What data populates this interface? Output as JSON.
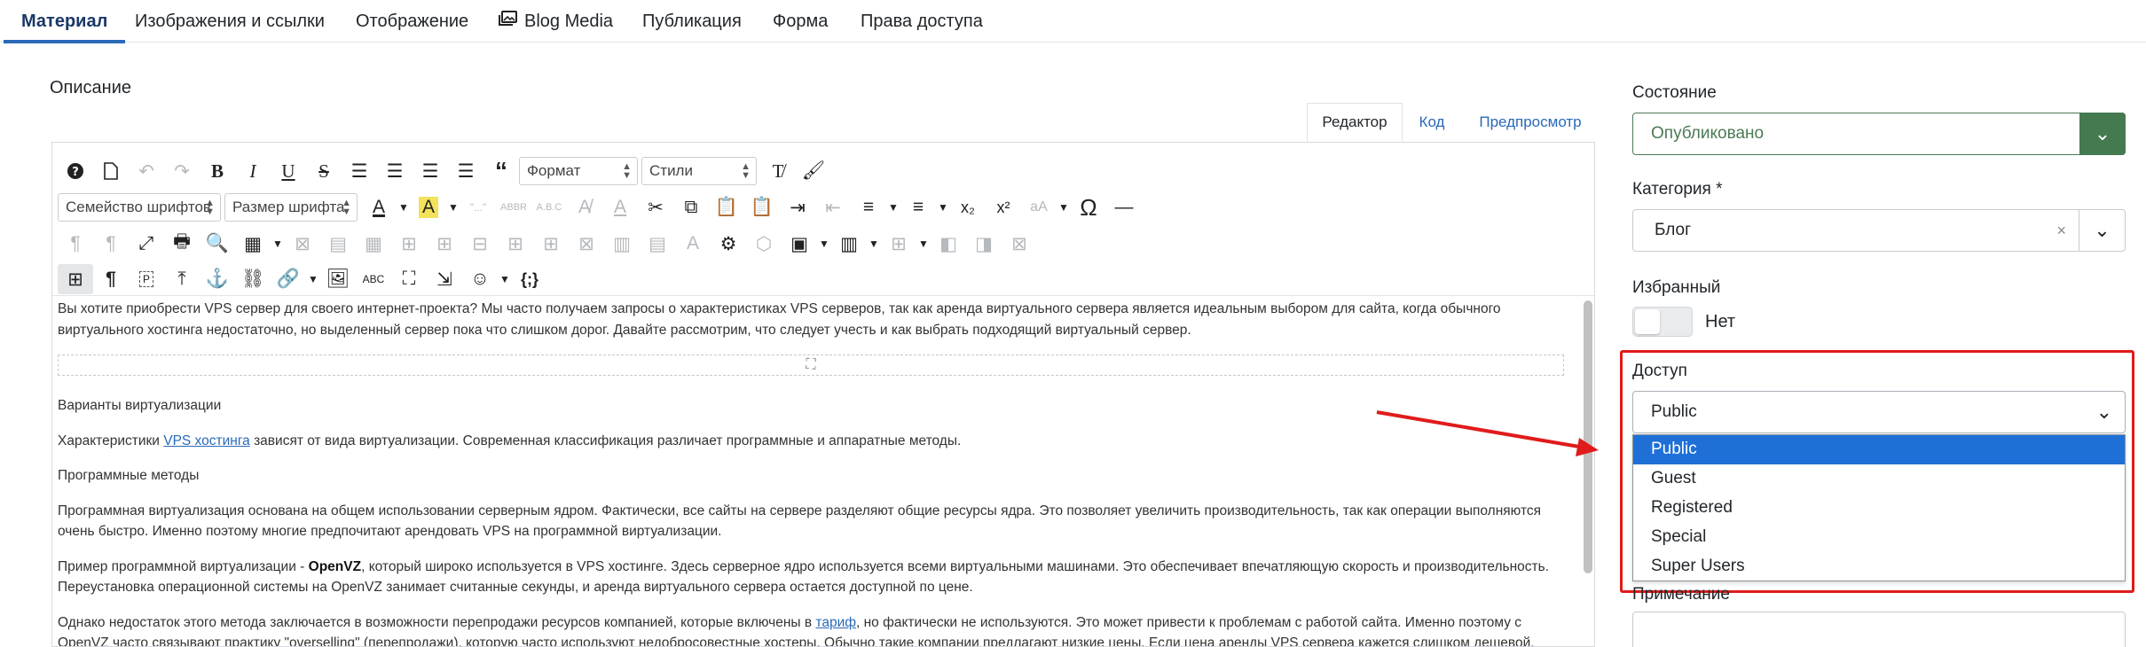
{
  "tabs": [
    {
      "label": "Материал",
      "active": true
    },
    {
      "label": "Изображения и ссылки",
      "active": false
    },
    {
      "label": "Отображение",
      "active": false
    },
    {
      "label": "Blog Media",
      "active": false,
      "icon": "images-icon"
    },
    {
      "label": "Публикация",
      "active": false
    },
    {
      "label": "Форма",
      "active": false
    },
    {
      "label": "Права доступа",
      "active": false
    }
  ],
  "description": {
    "label": "Описание",
    "editor_tabs": [
      "Редактор",
      "Код",
      "Предпросмотр"
    ],
    "toolbar": {
      "format_select": "Формат",
      "styles_select": "Стили",
      "font_family_select": "Семейство шрифтов",
      "font_size_select": "Размер шрифта"
    },
    "content": {
      "p1": "Вы хотите приобрести VPS сервер для своего интернет-проекта? Мы часто получаем запросы о характеристиках VPS серверов, так как аренда виртуального сервера является идеальным выбором для сайта, когда обычного виртуального хостинга недостаточно, но выделенный сервер пока что слишком дорог. Давайте рассмотрим, что следует учесть и как выбрать подходящий виртуальный сервер.",
      "h_virt": "Варианты виртуализации",
      "p2_before": "Характеристики ",
      "p2_link": "VPS хостинга",
      "p2_after": " зависят от вида виртуализации. Современная классификация различает программные и аппаратные методы.",
      "h_prog": "Программные методы",
      "p3": "Программная виртуализация основана на общем использовании серверным ядром. Фактически, все сайты на сервере разделяют общие ресурсы ядра. Это позволяет увеличить производительность, так как операции выполняются очень быстро. Именно поэтому многие предпочитают арендовать VPS на программной виртуализации.",
      "p4_before": "Пример программной виртуализации - ",
      "p4_bold": "OpenVZ",
      "p4_after": ", который широко используется в VPS хостинге. Здесь серверное ядро используется всеми виртуальными машинами. Это обеспечивает впечатляющую скорость и производительность. Переустановка операционной системы на OpenVZ занимает считанные секунды, и аренда виртуального сервера остается доступной по цене.",
      "p5_before": "Однако недостаток этого метода заключается в возможности перепродажи ресурсов компанией, которые включены в ",
      "p5_link": "тариф",
      "p5_after": ", но фактически не используются. Это может привести к проблемам с работой сайта. Именно поэтому с OpenVZ часто связывают практику \"overselling\" (перепродажи), которую часто используют недобросовестные хостеры. Обычно такие компании предлагают низкие цены. Если цена аренды VPS сервера кажется слишком дешевой, лучше"
    }
  },
  "sidebar": {
    "state_label": "Состояние",
    "state_value": "Опубликовано",
    "category_label": "Категория *",
    "category_value": "Блог",
    "category_clear": "×",
    "featured_label": "Избранный",
    "featured_value": "Нет",
    "access_label": "Доступ",
    "access_value": "Public",
    "access_options": [
      "Public",
      "Guest",
      "Registered",
      "Special",
      "Super Users"
    ],
    "note_label": "Примечание"
  },
  "colors": {
    "accent": "#2a69b8",
    "state_green": "#457a50",
    "highlight_red": "#e01b1b",
    "option_selected": "#1e70d7"
  }
}
